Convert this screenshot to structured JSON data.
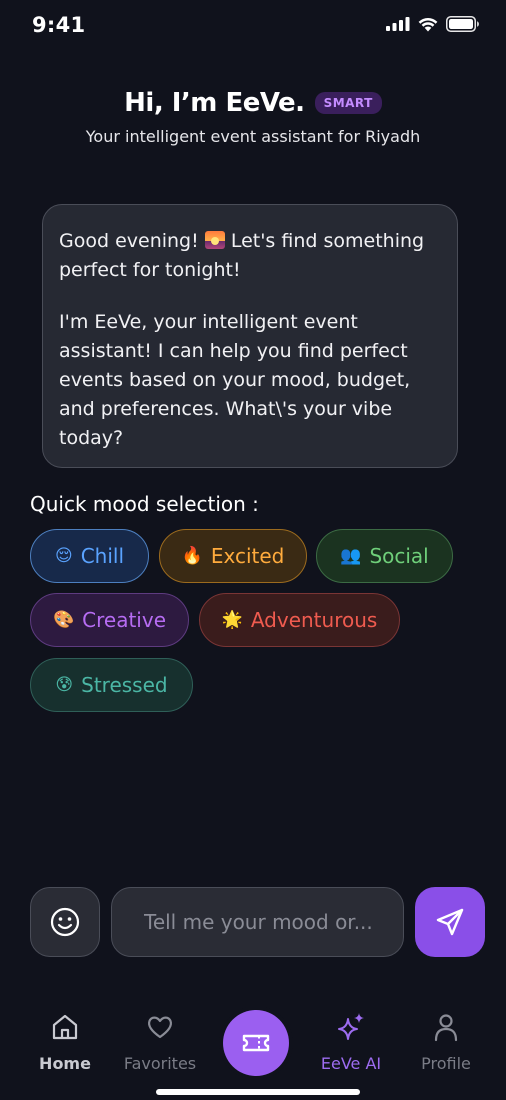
{
  "status_bar": {
    "time": "9:41"
  },
  "header": {
    "title": "Hi, I’m EeVe.",
    "badge": "SMART",
    "subtitle": "Your intelligent event assistant for Riyadh"
  },
  "chat": {
    "greeting_before": "Good evening! ",
    "greeting_after": " Let's find something perfect for tonight!",
    "body": "I'm EeVe, your intelligent event assistant! I can help you find perfect events based on your mood, budget, and preferences. What\\'s your vibe today?"
  },
  "mood": {
    "label": "Quick mood selection :",
    "chips": [
      {
        "emoji": "😌",
        "label": "Chill",
        "color": "#5aa3ff"
      },
      {
        "emoji": "🔥",
        "label": "Excited",
        "color": "#ffab3d"
      },
      {
        "emoji": "👥",
        "label": "Social",
        "color": "#6fcf7a"
      },
      {
        "emoji": "🎨",
        "label": "Creative",
        "color": "#b66cf2"
      },
      {
        "emoji": "🌟",
        "label": "Adventurous",
        "color": "#ef5b4f"
      },
      {
        "emoji": "😰",
        "label": "Stressed",
        "color": "#4bb6a5"
      }
    ]
  },
  "input": {
    "value": "",
    "placeholder": "Tell me your mood or..."
  },
  "tabs": [
    {
      "label": "Home",
      "icon": "home-icon",
      "active": false
    },
    {
      "label": "Favorites",
      "icon": "heart-icon",
      "active": false
    },
    {
      "label": "",
      "icon": "ticket-icon",
      "active": false
    },
    {
      "label": "EeVe AI",
      "icon": "sparkles-icon",
      "active": true
    },
    {
      "label": "Profile",
      "icon": "person-icon",
      "active": false
    }
  ],
  "colors": {
    "background": "#10121c",
    "accent": "#9b5ff0",
    "badge_text": "#c48cff"
  }
}
